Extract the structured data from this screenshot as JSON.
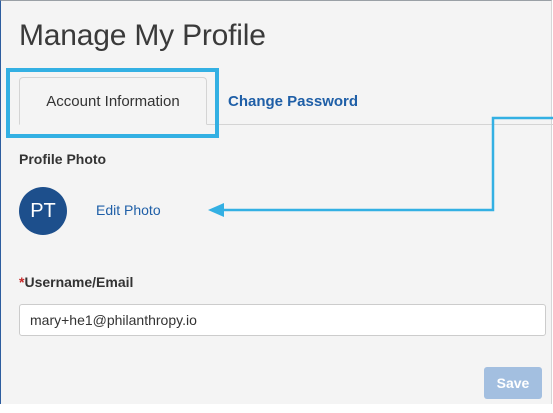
{
  "page": {
    "title": "Manage My Profile"
  },
  "tabs": [
    {
      "label": "Account Information",
      "active": true
    },
    {
      "label": "Change Password",
      "active": false
    }
  ],
  "profile_photo": {
    "label": "Profile Photo",
    "initials": "PT",
    "edit_label": "Edit Photo"
  },
  "username": {
    "required_marker": "*",
    "label": "Username/Email",
    "value": "mary+he1@philanthropy.io"
  },
  "actions": {
    "save_label": "Save"
  },
  "colors": {
    "highlight": "#33b0e3",
    "avatar_bg": "#1d4f8c",
    "link": "#1f5fa7",
    "save_disabled_bg": "#a3bfe0",
    "panel_bg": "#f4f4f4"
  }
}
